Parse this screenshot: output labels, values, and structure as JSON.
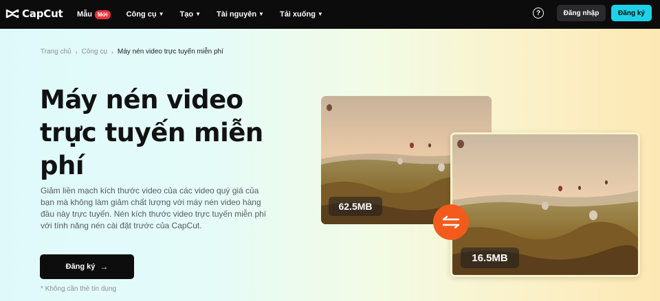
{
  "nav": {
    "brand": "CapCut",
    "items": [
      {
        "label": "Mẫu",
        "badge": "Mới",
        "chevron": false
      },
      {
        "label": "Công cụ",
        "chevron": true
      },
      {
        "label": "Tạo",
        "chevron": true
      },
      {
        "label": "Tài nguyên",
        "chevron": true
      },
      {
        "label": "Tải xuống",
        "chevron": true
      }
    ],
    "help_icon": "?",
    "login_label": "Đăng nhập",
    "signup_label": "Đăng ký"
  },
  "breadcrumb": [
    "Trang chủ",
    "Công cụ",
    "Máy nén video trực tuyến miễn phí"
  ],
  "hero": {
    "title": "Máy nén video trực tuyến miễn phí",
    "description": "Giảm liền mạch kích thước video của các video quý giá của bạn mà không làm giảm chất lượng với máy nén video hàng đầu này trực tuyến. Nén kích thước video trực tuyến miễn phí với tính năng nén cài đặt trước của CapCut.",
    "cta_label": "Đăng ký",
    "note": "* Không cần thẻ tín dụng"
  },
  "images": {
    "original_size": "62.5MB",
    "compressed_size": "16.5MB"
  },
  "colors": {
    "nav_bg": "#0c0c0d",
    "accent_cyan": "#1dd2e6",
    "badge_red": "#e8363c",
    "swap_orange": "#f35b1d"
  }
}
